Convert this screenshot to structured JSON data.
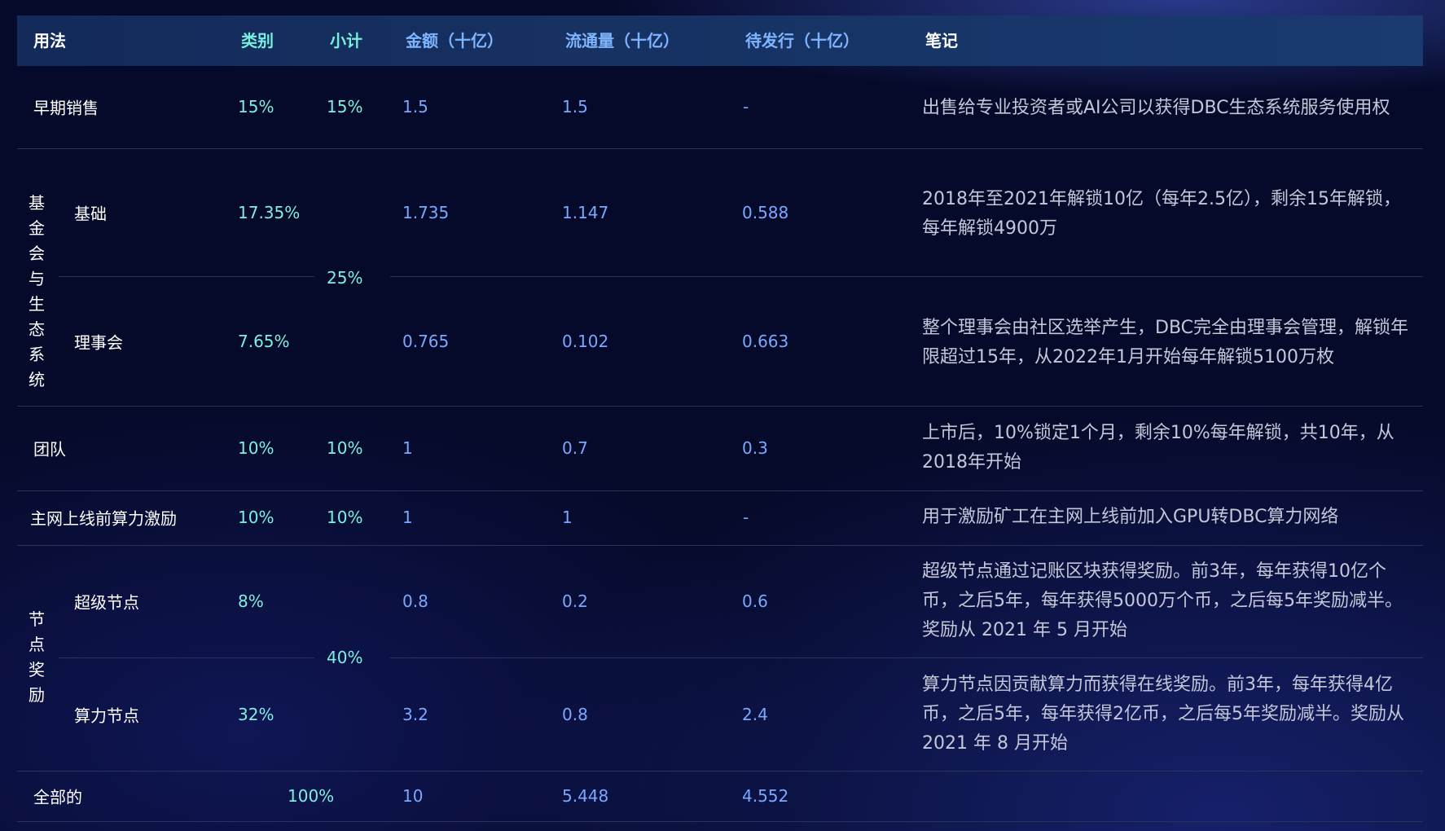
{
  "headers": {
    "usage": "用法",
    "category": "类别",
    "subtotal": "小计",
    "amount": "金额（十亿）",
    "circulation": "流通量（十亿）",
    "pending": "待发行（十亿）",
    "notes": "笔记"
  },
  "rows": {
    "early_sale": {
      "usage": "早期销售",
      "category": "15%",
      "subtotal": "15%",
      "amount": "1.5",
      "circulation": "1.5",
      "pending": "-",
      "note": "出售给专业投资者或AI公司以获得DBC生态系统服务使用权"
    },
    "foundation_group": {
      "label": [
        "基",
        "金",
        "会",
        "与",
        "生",
        "态",
        "系",
        "统"
      ],
      "subtotal": "25%",
      "basic": {
        "usage": "基础",
        "category": "17.35%",
        "amount": "1.735",
        "circulation": "1.147",
        "pending": "0.588",
        "note": "2018年至2021年解锁10亿（每年2.5亿），剩余15年解锁，每年解锁4900万"
      },
      "council": {
        "usage": "理事会",
        "category": "7.65%",
        "amount": "0.765",
        "circulation": "0.102",
        "pending": "0.663",
        "note": "整个理事会由社区选举产生，DBC完全由理事会管理，解锁年限超过15年，从2022年1月开始每年解锁5100万枚"
      }
    },
    "team": {
      "usage": "团队",
      "category": "10%",
      "subtotal": "10%",
      "amount": "1",
      "circulation": "0.7",
      "pending": "0.3",
      "note": "上市后，10%锁定1个月，剩余10%每年解锁，共10年，从2018年开始"
    },
    "pre_mainnet": {
      "usage": "主网上线前算力激励",
      "category": "10%",
      "subtotal": "10%",
      "amount": "1",
      "circulation": "1",
      "pending": "-",
      "note": "用于激励矿工在主网上线前加入GPU转DBC算力网络"
    },
    "node_group": {
      "label": [
        "节",
        "点",
        "奖",
        "励"
      ],
      "subtotal": "40%",
      "super": {
        "usage": "超级节点",
        "category": "8%",
        "amount": "0.8",
        "circulation": "0.2",
        "pending": "0.6",
        "note": "超级节点通过记账区块获得奖励。前3年，每年获得10亿个币，之后5年，每年获得5000万个币，之后每5年奖励减半。奖励从 2021 年 5 月开始"
      },
      "compute": {
        "usage": "算力节点",
        "category": "32%",
        "amount": "3.2",
        "circulation": "0.8",
        "pending": "2.4",
        "note": "算力节点因贡献算力而获得在线奖励。前3年，每年获得4亿币，之后5年，每年获得2亿币，之后每5年奖励减半。奖励从 2021 年 8 月开始"
      }
    },
    "total": {
      "usage": "全部的",
      "subtotal": "100%",
      "amount": "10",
      "circulation": "5.448",
      "pending": "4.552"
    }
  }
}
